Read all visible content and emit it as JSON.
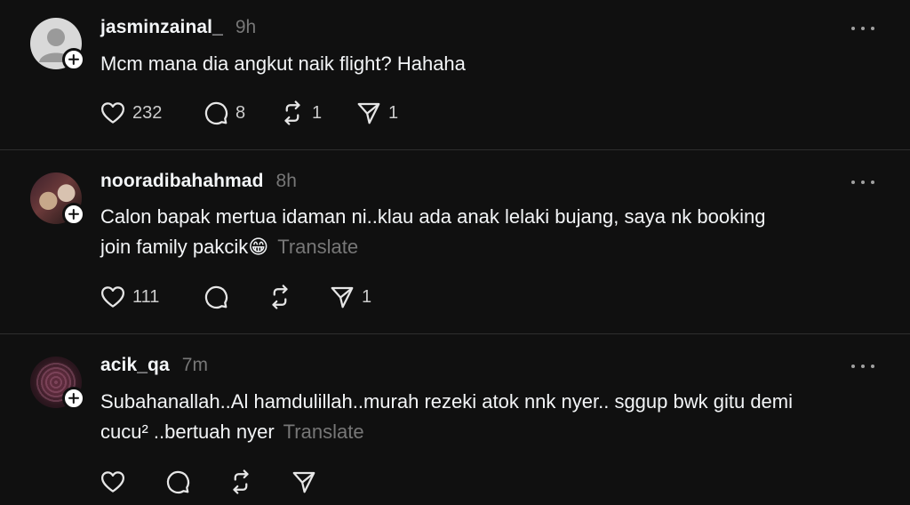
{
  "comments": [
    {
      "username": "jasminzainal_",
      "time": "9h",
      "text": "Mcm mana dia angkut naik flight? Hahaha",
      "text_line2": "",
      "translate": "",
      "likes": "232",
      "replies": "8",
      "reposts": "1",
      "shares": "1"
    },
    {
      "username": "nooradibahahmad",
      "time": "8h",
      "text": "Calon bapak mertua idaman ni..klau ada anak lelaki bujang, saya nk booking",
      "text_line2": "join family pakcik😁",
      "translate": "Translate",
      "likes": "111",
      "replies": "",
      "reposts": "",
      "shares": "1"
    },
    {
      "username": "acik_qa",
      "time": "7m",
      "text": "Subahanallah..Al hamdulillah..murah rezeki atok nnk nyer.. sggup bwk gitu demi",
      "text_line2": "cucu² ..bertuah nyer",
      "translate": "Translate",
      "likes": "",
      "replies": "",
      "reposts": "",
      "shares": ""
    }
  ],
  "icons": {
    "like": "heart-icon",
    "reply": "comment-bubble-icon",
    "repost": "repost-icon",
    "share": "send-icon",
    "more": "more-dots-icon",
    "follow": "plus-icon"
  },
  "colors": {
    "background": "#101010",
    "primary_text": "#f3f5f7",
    "secondary_text": "#777777",
    "divider": "#2e2e2e"
  }
}
